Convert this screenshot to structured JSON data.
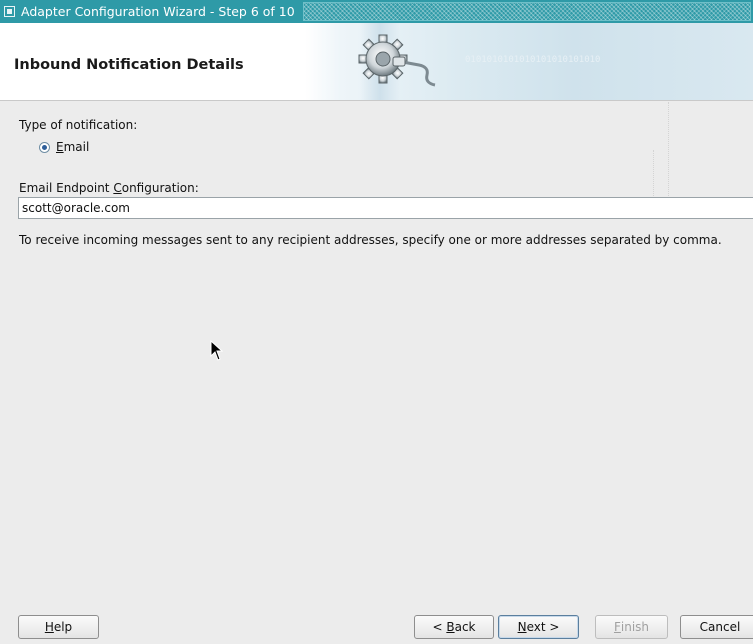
{
  "window": {
    "title": "Adapter Configuration Wizard - Step 6 of 10"
  },
  "header": {
    "heading": "Inbound Notification Details",
    "binary_text": "0101010101010101010101010"
  },
  "notification": {
    "type_label": "Type of notification:",
    "option_mnemonic": "E",
    "option_rest": "mail",
    "selected": "Email"
  },
  "endpoint": {
    "label_before": "Email Endpoint ",
    "label_mnemonic": "C",
    "label_after": "onfiguration:",
    "value": "scott@oracle.com"
  },
  "help_text": "To receive incoming messages sent to any recipient addresses, specify one or more addresses separated by comma.",
  "buttons": {
    "help_mnemonic": "H",
    "help_rest": "elp",
    "back_prefix": "< ",
    "back_mnemonic": "B",
    "back_rest": "ack",
    "next_mnemonic": "N",
    "next_rest": "ext >",
    "finish_mnemonic": "F",
    "finish_rest": "inish",
    "cancel": "Cancel"
  },
  "colors": {
    "titlebar": "#2e9aa7",
    "radio_selected": "#2f5f9a"
  }
}
